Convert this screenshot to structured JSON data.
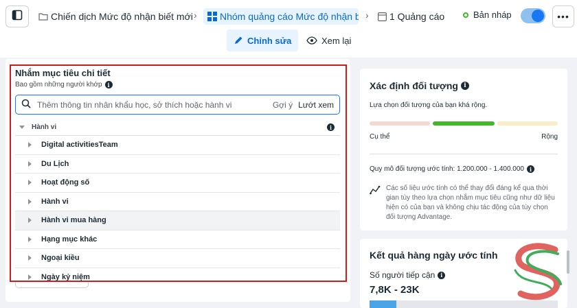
{
  "breadcrumbs": {
    "campaign": "Chiến dịch Mức độ nhận biết mới",
    "adset": "Nhóm quảng cáo Mức độ nhận biế",
    "ads": "1 Quảng cáo"
  },
  "status": {
    "label": "Bản nháp",
    "toggle_on": true
  },
  "tabs": {
    "edit": "Chỉnh sửa",
    "review": "Xem lại"
  },
  "detailed_targeting": {
    "title": "Nhắm mục tiêu chi tiết",
    "subtitle": "Bao gồm những người khớp",
    "search": {
      "placeholder": "Thêm thông tin nhân khẩu học, sở thích hoặc hành vi",
      "suggestions": "Gợi ý",
      "browse": "Lướt xem"
    },
    "category": "Hành vi",
    "items": [
      {
        "label": "Digital activitiesTeam"
      },
      {
        "label": "Du Lịch"
      },
      {
        "label": "Hoạt động số"
      },
      {
        "label": "Hành vi"
      },
      {
        "label": "Hành vi mua hàng"
      },
      {
        "label": "Hạng mục khác"
      },
      {
        "label": "Ngoại kiều"
      },
      {
        "label": "Ngày kỷ niệm"
      }
    ]
  },
  "audience": {
    "title": "Xác định đối tượng",
    "description": "Lựa chọn đối tượng của bạn khá rộng.",
    "specific": "Cụ thể",
    "broad": "Rộng",
    "estimate": "Quy mô đối tượng ước tính: 1.200.000 - 1.400.000",
    "note": "Các số liệu ước tính có thể thay đổi đáng kể qua thời gian tùy theo lựa chọn nhắm mục tiêu cũng như dữ liệu hiện có của bạn và không chịu tác động của tùy chọn đối tượng Advantage.",
    "colors": {
      "narrow": "#f8d7d3",
      "good": "#42b72a",
      "wide": "#fbeec4"
    }
  },
  "daily_results": {
    "title": "Kết quả hàng ngày ước tính",
    "reach_label": "Số người tiếp cận",
    "reach_value": "7,8K - 23K"
  },
  "accent": "#1877f2"
}
